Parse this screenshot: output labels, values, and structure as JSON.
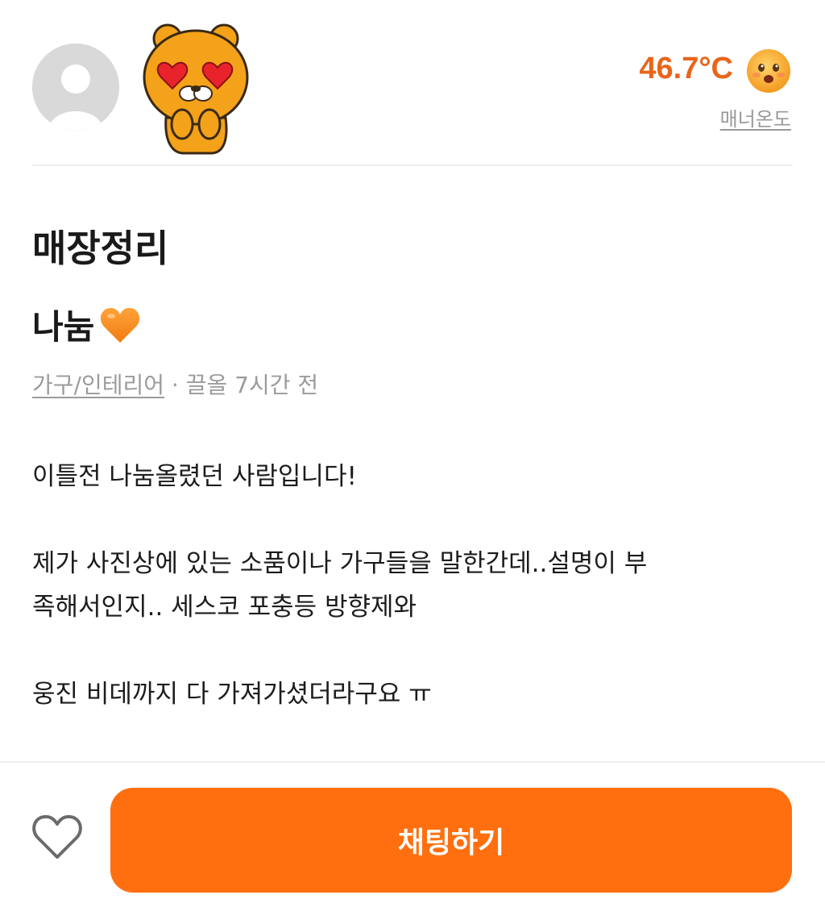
{
  "seller": {
    "manner_temperature": "46.7°C",
    "manner_label": "매너온도",
    "avatar_icon": "default-profile-icon",
    "sticker_icon": "lion-character-heart-eyes-sticker",
    "manner_face_icon": "smiling-face-icon"
  },
  "article": {
    "title": "매장정리",
    "subtitle": "나눔",
    "subtitle_icon": "orange-heart-icon",
    "category": "가구/인테리어",
    "separator": "·",
    "bump_time": "끌올 7시간 전",
    "body": {
      "line1": "이틀전 나눔올렸던 사람입니다!",
      "line2": "제가 사진상에 있는 소품이나 가구들을 말한간데..설명이 부",
      "line3": "족해서인지.. 세스코 포충등 방향제와",
      "line4": "웅진 비데까지 다 가져가셨더라구요 ㅠ"
    }
  },
  "bottom_bar": {
    "like_icon": "heart-outline-icon",
    "chat_label": "채팅하기"
  },
  "colors": {
    "accent": "#ff6f0f",
    "temperature": "#e8651a",
    "muted_text": "#9b9b9b"
  }
}
